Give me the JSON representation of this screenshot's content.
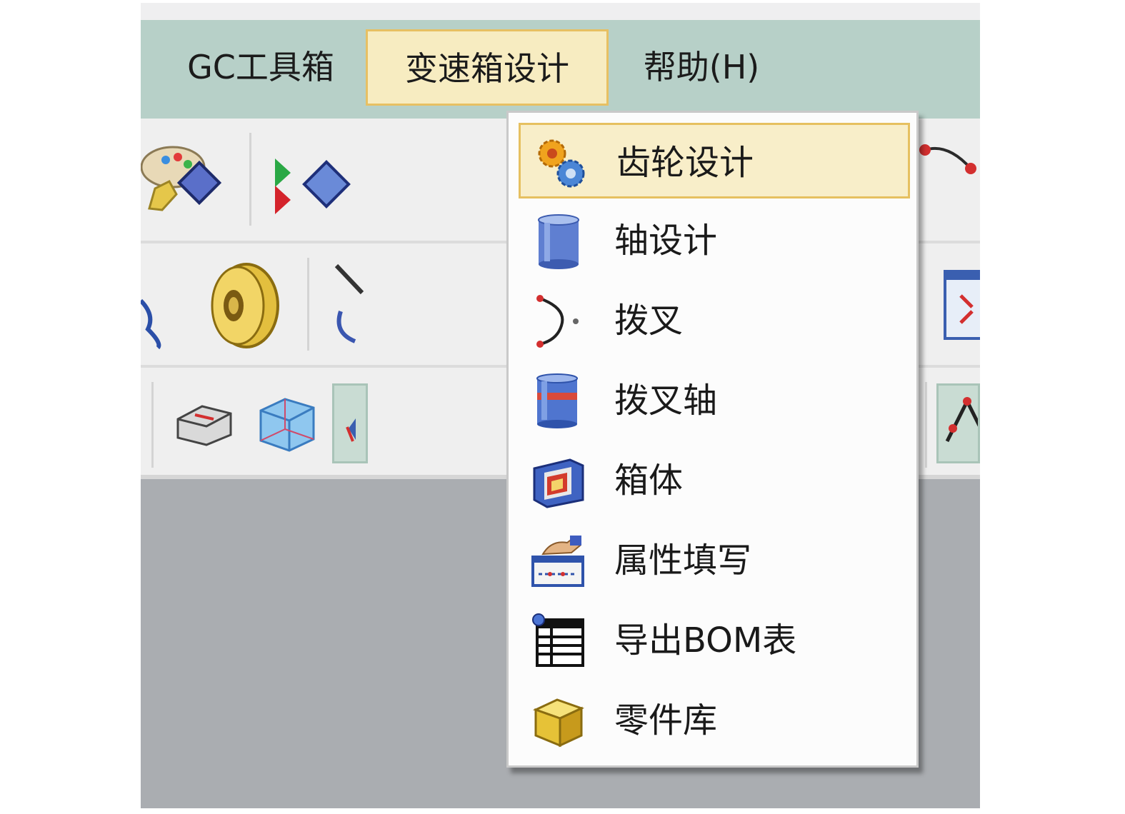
{
  "menubar": {
    "items": [
      {
        "label": "GC工具箱"
      },
      {
        "label": "变速箱设计",
        "active": true
      },
      {
        "label": "帮助(H)"
      }
    ]
  },
  "dropdown": {
    "parent": "变速箱设计",
    "items": [
      {
        "label": "齿轮设计",
        "icon": "gears-icon",
        "highlighted": true
      },
      {
        "label": "轴设计",
        "icon": "cylinder-shaft-icon"
      },
      {
        "label": "拨叉",
        "icon": "fork-arc-icon"
      },
      {
        "label": "拨叉轴",
        "icon": "fork-shaft-icon"
      },
      {
        "label": "箱体",
        "icon": "housing-box-icon"
      },
      {
        "label": "属性填写",
        "icon": "attribute-fill-icon"
      },
      {
        "label": "导出BOM表",
        "icon": "bom-table-icon"
      },
      {
        "label": "零件库",
        "icon": "part-library-icon"
      }
    ]
  },
  "colors": {
    "menubar_bg": "#b7d0c8",
    "highlight_bg": "#f8eec9",
    "highlight_border": "#e6c060",
    "workspace_bg": "#aaadb1",
    "toolbar_bg": "#efefef"
  }
}
